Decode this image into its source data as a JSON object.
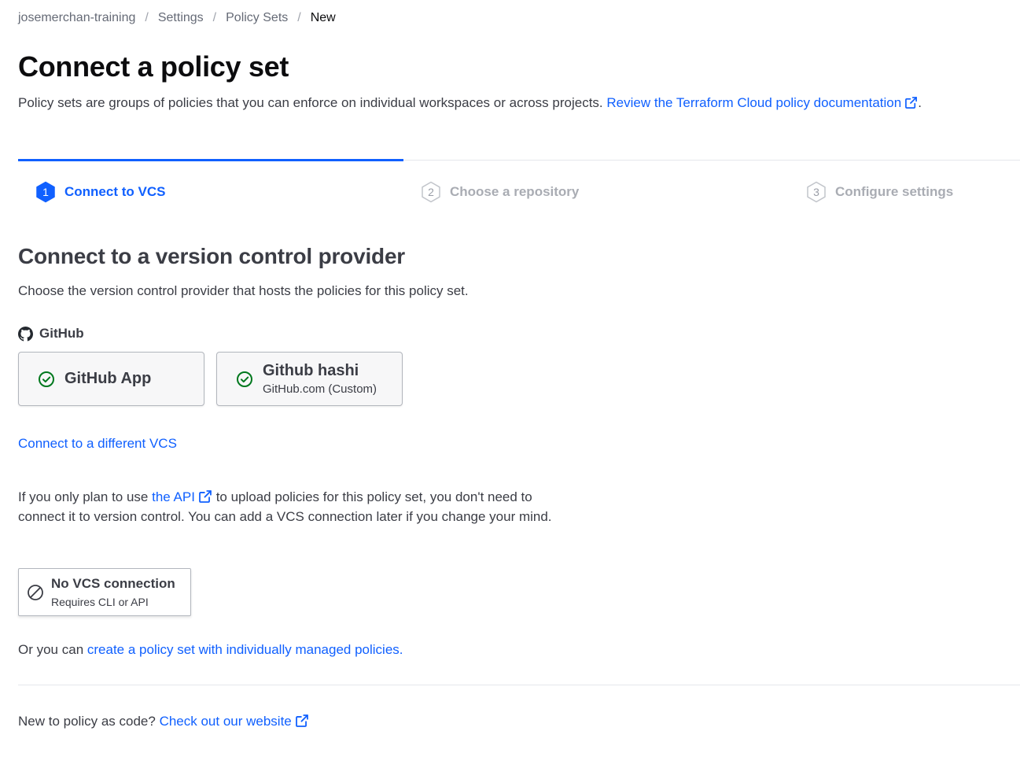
{
  "breadcrumb": {
    "items": [
      "josemerchan-training",
      "Settings",
      "Policy Sets"
    ],
    "current": "New",
    "separator": "/"
  },
  "header": {
    "title": "Connect a policy set",
    "description": "Policy sets are groups of policies that you can enforce on individual workspaces or across projects.",
    "doc_link": "Review the Terraform Cloud policy documentation",
    "doc_suffix": "."
  },
  "stepper": {
    "steps": [
      {
        "number": "1",
        "label": "Connect to VCS",
        "state": "active"
      },
      {
        "number": "2",
        "label": "Choose a repository",
        "state": "inactive"
      },
      {
        "number": "3",
        "label": "Configure settings",
        "state": "inactive"
      }
    ]
  },
  "main": {
    "title": "Connect to a version control provider",
    "description": "Choose the version control provider that hosts the policies for this policy set.",
    "provider_group": "GitHub",
    "providers": [
      {
        "name": "GitHub App",
        "subtitle": ""
      },
      {
        "name": "Github hashi",
        "subtitle": "GitHub.com (Custom)"
      }
    ],
    "different_vcs_link": "Connect to a different VCS",
    "api_text_before": "If you only plan to use",
    "api_link": "the API",
    "api_text_after": "to upload policies for this policy set, you don't need to connect it to version control. You can add a VCS connection later if you change your mind.",
    "no_vcs": {
      "name": "No VCS connection",
      "subtitle": "Requires CLI or API"
    },
    "alt_text_before": "Or you can",
    "alt_link": "create a policy set with individually managed policies."
  },
  "footer": {
    "text": "New to policy as code?",
    "link": "Check out our website"
  },
  "colors": {
    "accent": "#1060ff",
    "success": "#00781e",
    "text": "#3b3d45",
    "muted": "#a9acb3"
  },
  "icons": [
    "external-link-icon",
    "github-icon",
    "check-circle-icon",
    "ban-icon",
    "hexagon-step-icon"
  ]
}
